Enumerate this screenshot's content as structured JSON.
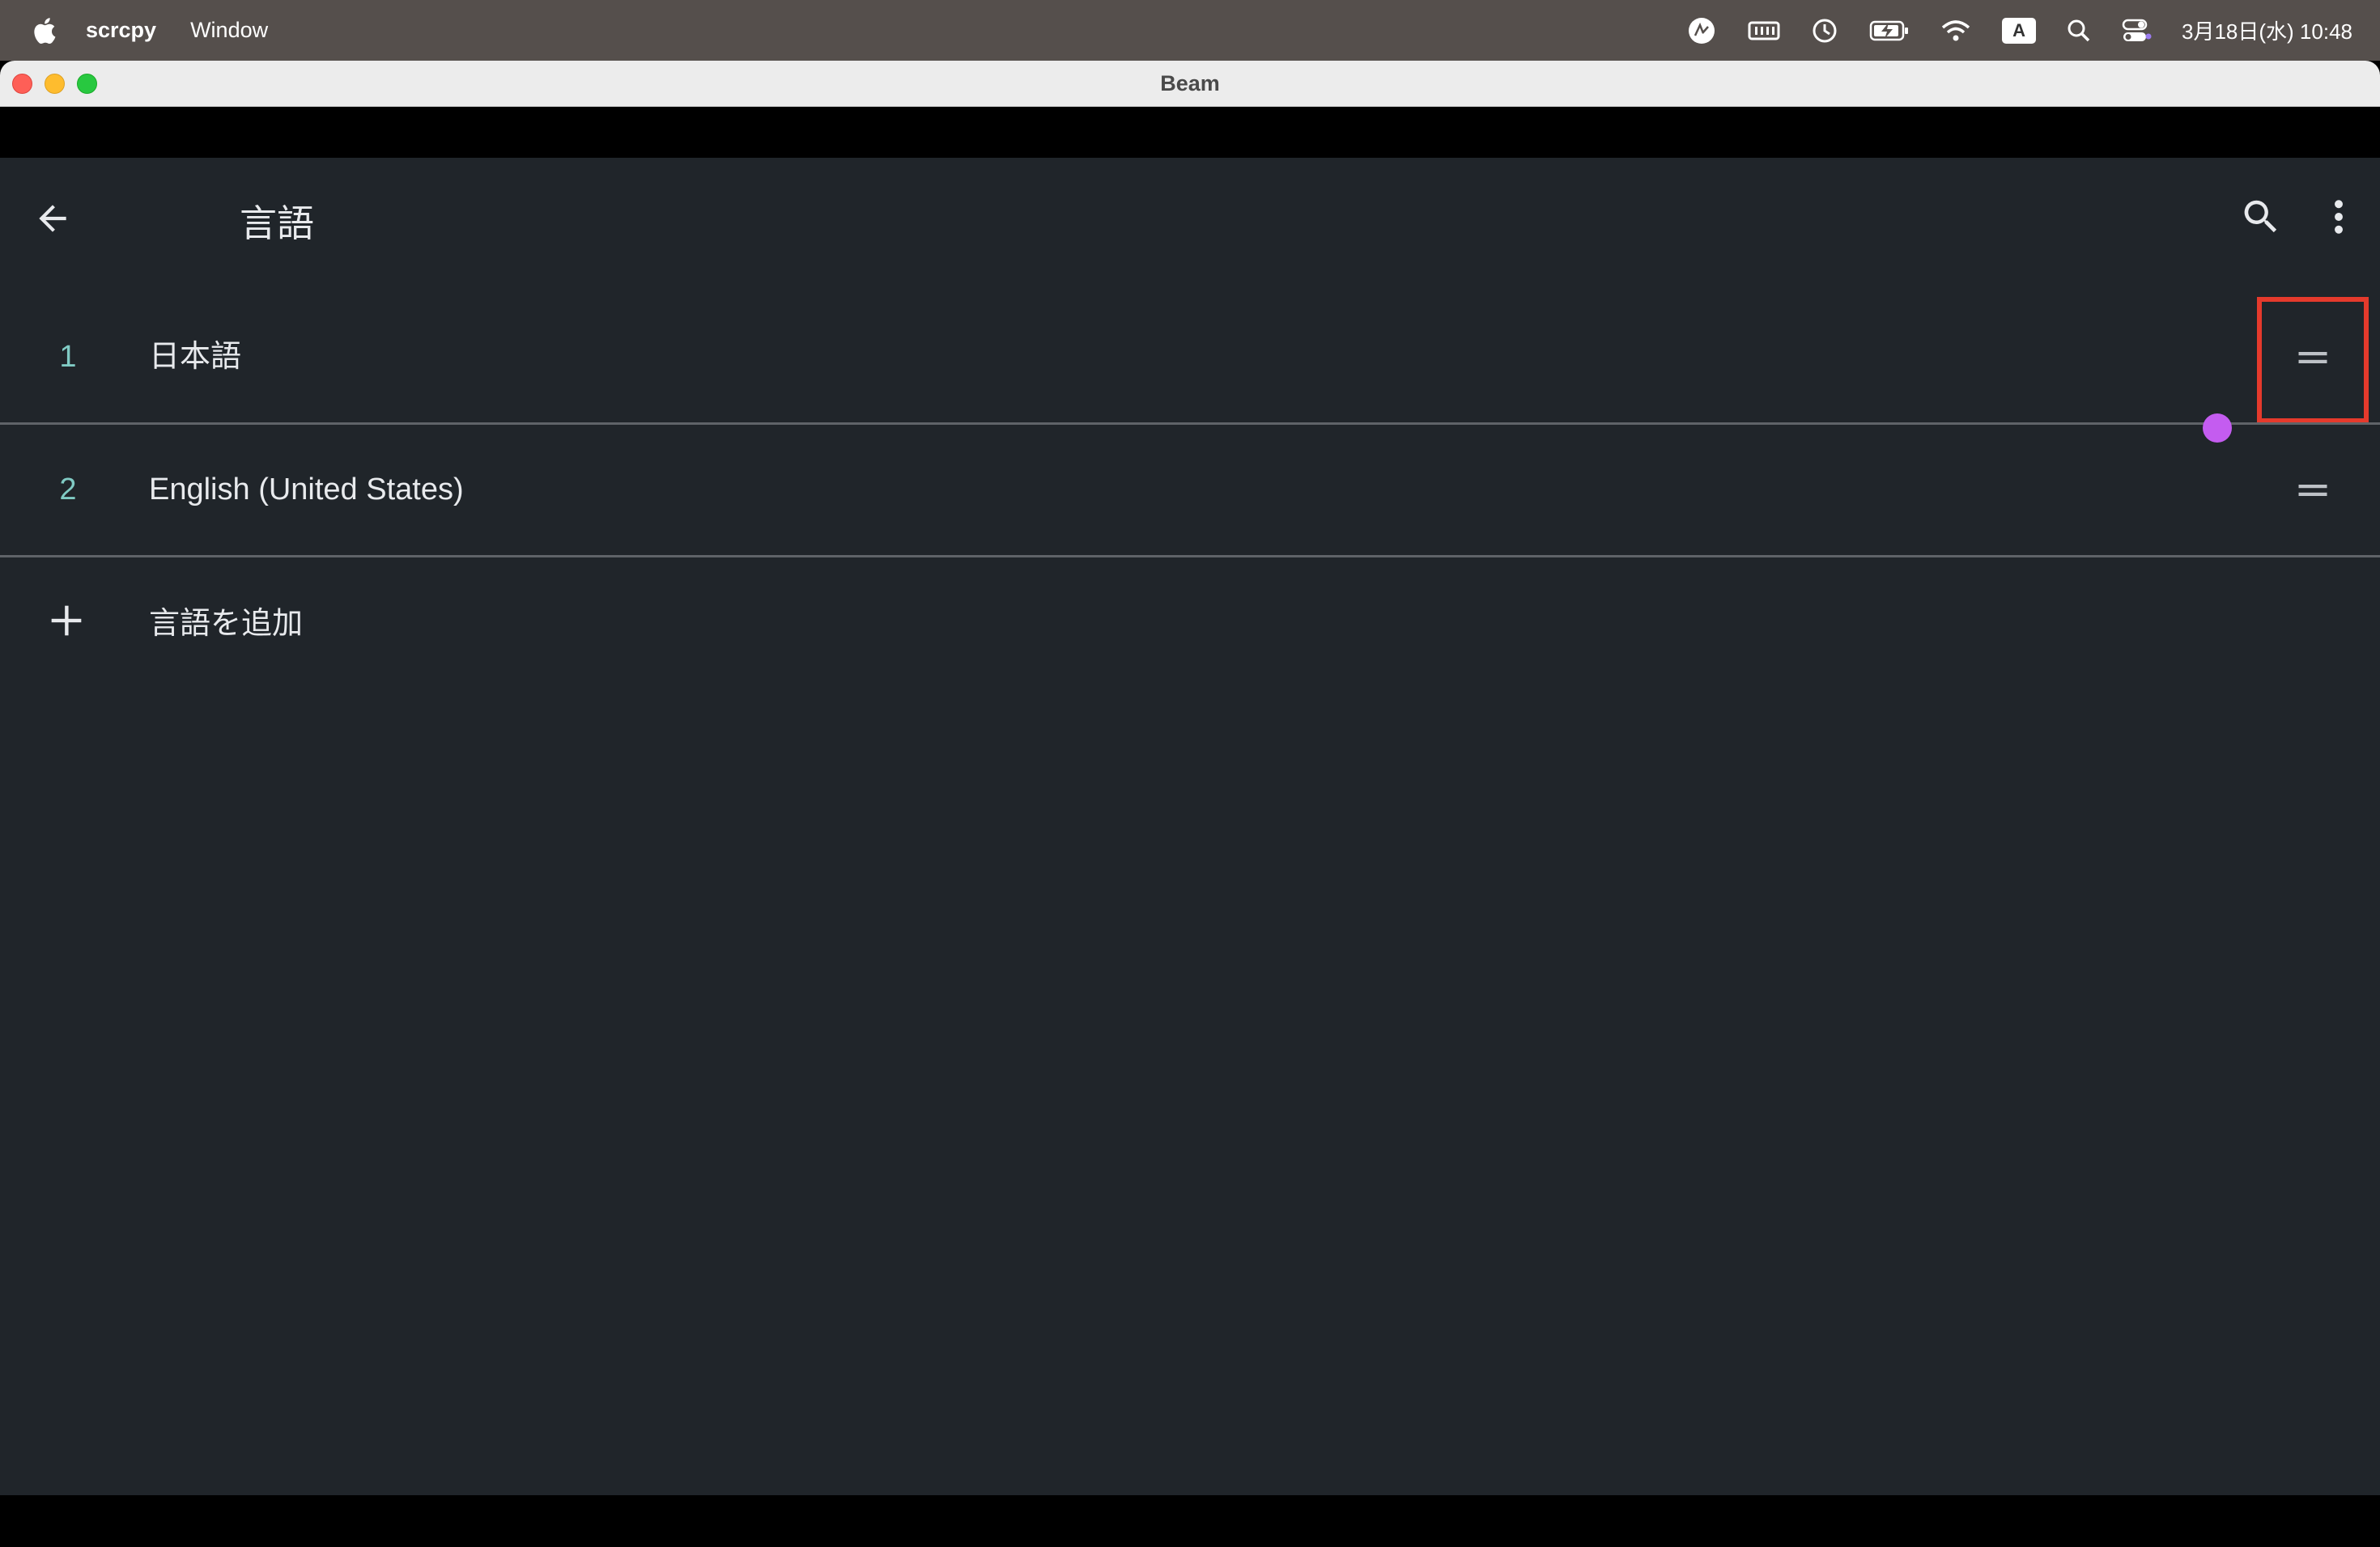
{
  "menubar": {
    "app_name": "scrcpy",
    "menu_items": [
      "Window"
    ],
    "tray_icons": [
      "ai-assistant-icon",
      "memory-icon",
      "time-machine-icon",
      "battery-charging-icon",
      "wifi-icon",
      "input-source-icon",
      "spotlight-search-icon",
      "control-center-icon"
    ],
    "input_source": "A",
    "clock": "3月18日(水) 10:48"
  },
  "window": {
    "title": "Beam"
  },
  "screen": {
    "page_title": "言語",
    "languages": [
      {
        "number": "1",
        "name": "日本語"
      },
      {
        "number": "2",
        "name": "English (United States)"
      }
    ],
    "add_language_label": "言語を追加",
    "colors": {
      "background": "#20252a",
      "accent_number": "#80cbc4",
      "highlight": "#e53a2c",
      "touch_indicator": "#c45cf0"
    }
  }
}
